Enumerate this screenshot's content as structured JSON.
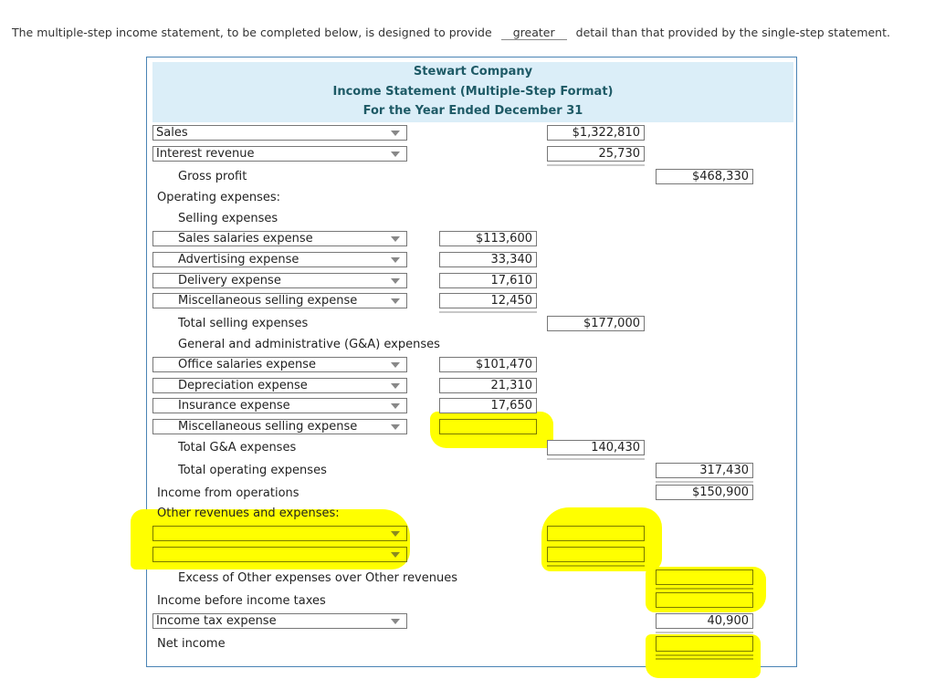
{
  "question": {
    "before": "The multiple-step income statement, to be completed below, is designed to provide",
    "answer": "greater",
    "after": "detail than that provided by the single-step statement."
  },
  "statement": {
    "company": "Stewart Company",
    "title": "Income Statement  (Multiple-Step Format)",
    "period": "For the Year Ended December 31",
    "sales": {
      "account": "Sales",
      "amount": "$1,322,810"
    },
    "interest_revenue": {
      "account": "Interest revenue",
      "amount": "25,730"
    },
    "gross_profit": {
      "label": "Gross profit",
      "amount": "$468,330"
    },
    "operating_expenses_label": "Operating expenses:",
    "selling_expenses_label": "Selling expenses",
    "selling_items": [
      {
        "account": "Sales salaries expense",
        "amount": "$113,600"
      },
      {
        "account": "Advertising expense",
        "amount": "33,340"
      },
      {
        "account": "Delivery expense",
        "amount": "17,610"
      },
      {
        "account": "Miscellaneous selling expense",
        "amount": "12,450"
      }
    ],
    "total_selling": {
      "label": "Total selling expenses",
      "amount": "$177,000"
    },
    "ga_expenses_label": "General and administrative (G&A) expenses",
    "ga_items": [
      {
        "account": "Office salaries expense",
        "amount": "$101,470"
      },
      {
        "account": "Depreciation expense",
        "amount": "21,310"
      },
      {
        "account": "Insurance expense",
        "amount": "17,650"
      },
      {
        "account": "Miscellaneous selling expense",
        "amount": ""
      }
    ],
    "total_ga": {
      "label": "Total G&A expenses",
      "amount": "140,430"
    },
    "total_operating": {
      "label": "Total operating expenses",
      "amount": "317,430"
    },
    "income_from_operations": {
      "label": "Income from operations",
      "amount": "$150,900"
    },
    "other_label": "Other revenues and expenses:",
    "other_items": [
      {
        "account": "",
        "amount": ""
      },
      {
        "account": "",
        "amount": ""
      }
    ],
    "excess_other": {
      "label": "Excess of Other expenses over Other revenues",
      "amount": ""
    },
    "income_before_taxes": {
      "label": "Income before income taxes",
      "amount": ""
    },
    "income_tax": {
      "account": "Income tax expense",
      "amount": "40,900"
    },
    "net_income": {
      "label": "Net income",
      "amount": ""
    }
  },
  "colors": {
    "header_bg": "#dbeef8",
    "header_text": "#1e5a66",
    "panel_border": "#4a84b5",
    "highlight": "#ffff00"
  }
}
